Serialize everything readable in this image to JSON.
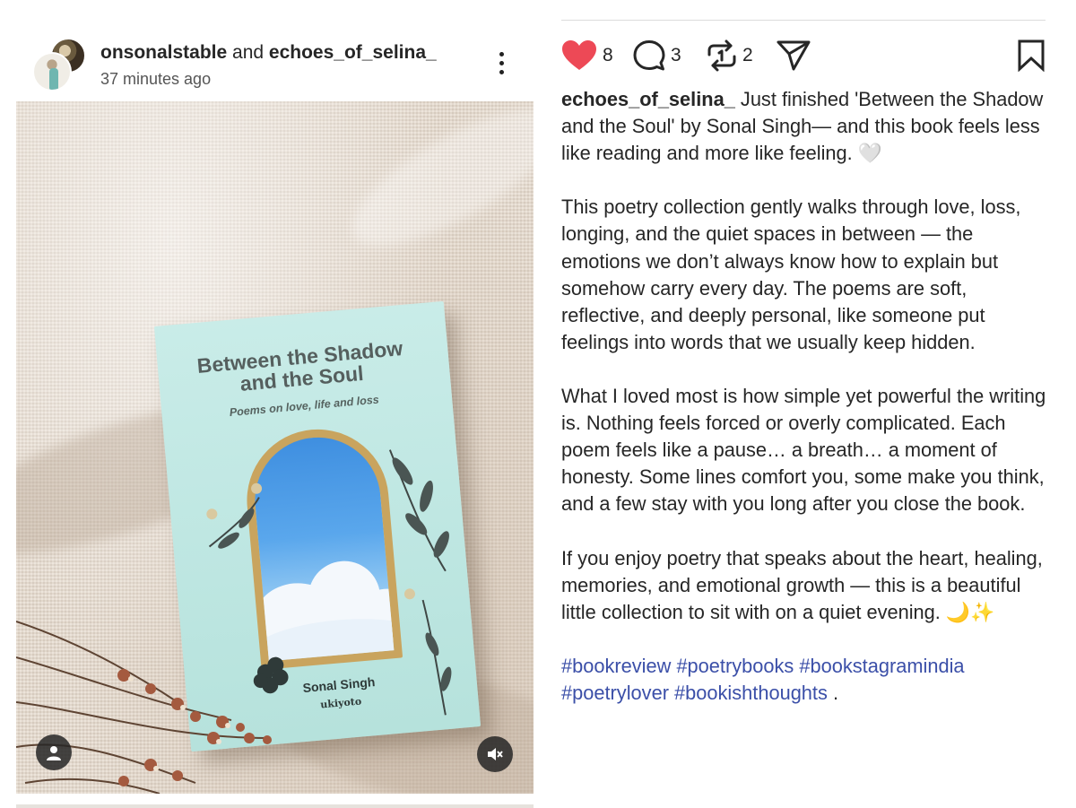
{
  "post": {
    "author_primary": "onsonalstable",
    "author_joiner": " and ",
    "author_collab": "echoes_of_selina_",
    "time_ago": "37 minutes ago"
  },
  "book_cover": {
    "title": "Between the Shadow and the Soul",
    "subtitle": "Poems on love, life and loss",
    "author": "Sonal Singh",
    "publisher": "ukiyoto"
  },
  "actions": {
    "like_count": "8",
    "comment_count": "3",
    "repost_count": "2",
    "like_color": "#ed4956"
  },
  "caption": {
    "username": "echoes_of_selina_",
    "paragraphs": [
      " Just finished 'Between the Shadow and the Soul' by Sonal Singh— and this book feels less like reading and more like feeling. 🤍",
      "This poetry collection gently walks through love, loss, longing, and the quiet spaces in between — the emotions we don’t always know how to explain but somehow carry every day. The poems are soft, reflective, and deeply personal, like someone put feelings into words that we usually keep hidden.",
      "What I loved most is how simple yet powerful the writing is. Nothing feels forced or overly complicated. Each poem feels like a pause… a breath… a moment of honesty. Some lines comfort you, some make you think, and a few stay with you long after you close the book.",
      "If you enjoy poetry that speaks about the heart, healing, memories, and emotional growth — this is a beautiful little collection to sit with on a quiet evening. 🌙✨"
    ],
    "hashtags": [
      "#bookreview",
      "#poetrybooks",
      "#bookstagramindia",
      "#poetrylover",
      "#bookishthoughts"
    ],
    "trailing": " ."
  },
  "icons": {
    "more": "more-vertical-icon",
    "like": "heart-filled-icon",
    "comment": "comment-bubble-icon",
    "repost": "repost-icon",
    "share": "send-icon",
    "save": "bookmark-icon",
    "user_tag": "user-icon",
    "audio": "speaker-muted-icon"
  },
  "colors": {
    "hashtag": "#3b4fa8",
    "text": "#262626"
  }
}
